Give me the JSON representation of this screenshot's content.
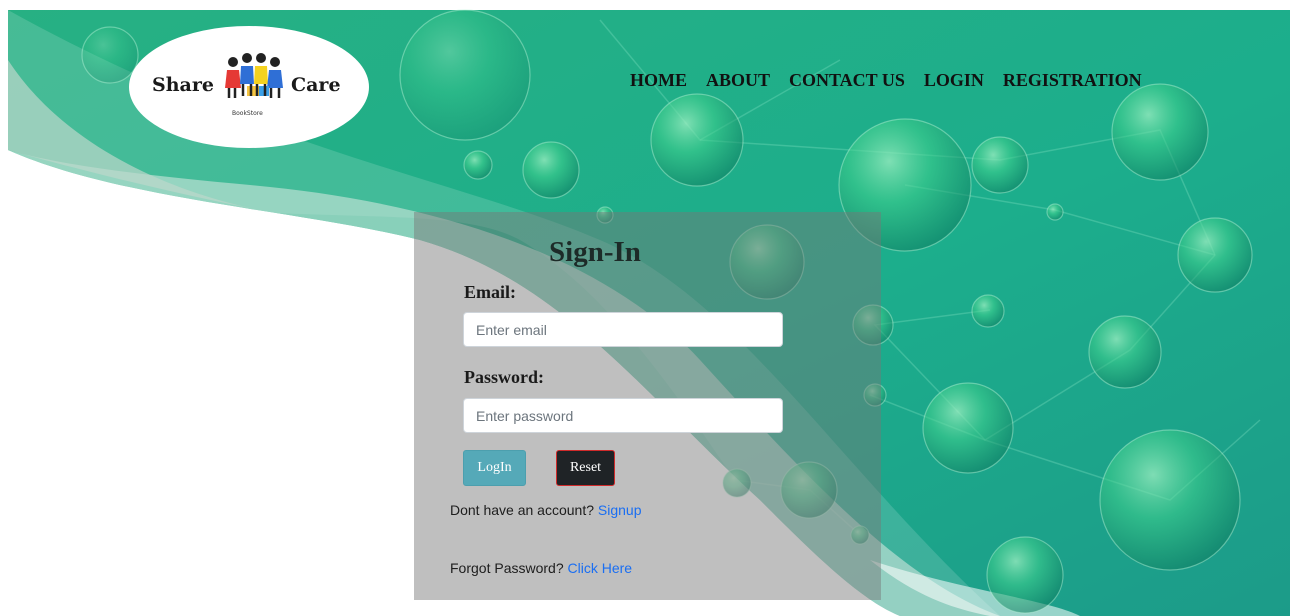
{
  "brand": {
    "word_left": "Share",
    "word_right": "Care",
    "subtitle": "BookStore"
  },
  "nav": {
    "items": [
      {
        "label": "HOME"
      },
      {
        "label": "ABOUT"
      },
      {
        "label": "CONTACT US"
      },
      {
        "label": "LOGIN"
      },
      {
        "label": "REGISTRATION"
      }
    ]
  },
  "form": {
    "title": "Sign-In",
    "email_label": "Email:",
    "email_placeholder": "Enter email",
    "email_value": "",
    "password_label": "Password:",
    "password_placeholder": "Enter password",
    "password_value": "",
    "login_label": "LogIn",
    "reset_label": "Reset",
    "signup_prompt": "Dont have an account?",
    "signup_link": "Signup",
    "forgot_prompt": "Forgot Password?",
    "forgot_link": "Click Here"
  },
  "colors": {
    "bg_teal": "#1fb08a",
    "bg_teal_dark": "#1a9a86",
    "panel_overlay": "#787878",
    "login_button": "#55a9b8",
    "reset_button": "#1f2326",
    "link": "#1a6ef2"
  }
}
